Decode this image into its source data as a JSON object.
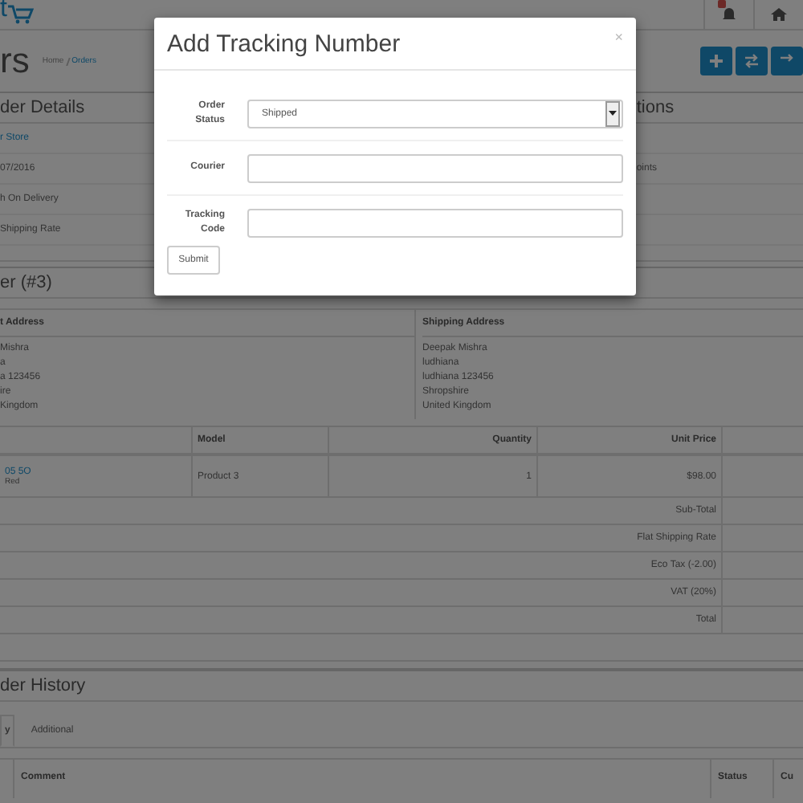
{
  "header": {
    "logo": "t"
  },
  "page": {
    "title": "rs",
    "breadcrumb": [
      {
        "label": "Home"
      },
      {
        "label": "Orders"
      }
    ]
  },
  "order_details": {
    "title": "der Details",
    "rows": [
      {
        "text": "r Store",
        "kind": "link"
      },
      {
        "text": "07/2016",
        "kind": "text"
      },
      {
        "text": "h On Delivery",
        "kind": "text"
      },
      {
        "text": "Shipping Rate",
        "kind": "text"
      }
    ]
  },
  "options_panel": {
    "title": "tions",
    "rows": [
      {
        "text": "oints"
      }
    ]
  },
  "order": {
    "title": "er (#3)",
    "payment_address": {
      "heading": "t Address",
      "lines": [
        "Mishra",
        "a",
        "a 123456",
        "ire",
        "Kingdom"
      ]
    },
    "shipping_address": {
      "heading": "Shipping Address",
      "lines": [
        "Deepak Mishra",
        "ludhiana",
        "ludhiana 123456",
        "Shropshire",
        "United Kingdom"
      ]
    }
  },
  "products": {
    "columns": [
      "Model",
      "Quantity",
      "Unit Price"
    ],
    "rows": [
      {
        "name": "05 5O",
        "option": "Red",
        "model": "Product 3",
        "quantity": "1",
        "unit_price": "$98.00"
      }
    ],
    "totals": [
      "Sub-Total",
      "Flat Shipping Rate",
      "Eco Tax (-2.00)",
      "VAT (20%)",
      "Total"
    ]
  },
  "history": {
    "title": "der History",
    "tabs": [
      {
        "label": "y",
        "selected": true
      },
      {
        "label": "Additional",
        "selected": false
      }
    ],
    "columns": [
      "Comment",
      "Status",
      "Cu"
    ]
  },
  "modal": {
    "title": "Add Tracking Number",
    "close": "×",
    "fields": [
      {
        "label": "Order Status",
        "kind": "select",
        "value": "Shipped"
      },
      {
        "label": "Courier",
        "kind": "text"
      },
      {
        "label": "Tracking Code",
        "kind": "text"
      }
    ],
    "submit": "Submit"
  }
}
